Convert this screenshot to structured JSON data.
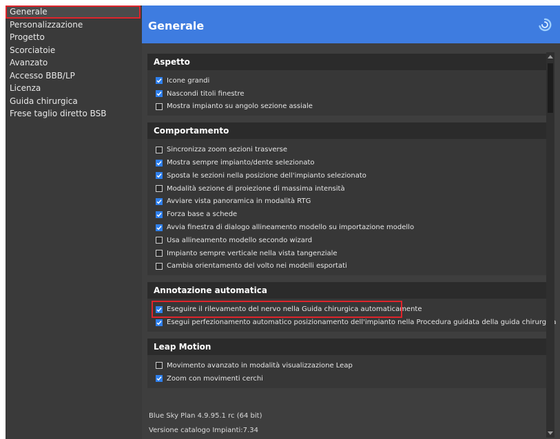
{
  "sidebar": {
    "items": [
      {
        "label": "Generale",
        "selected": true
      },
      {
        "label": "Personalizzazione"
      },
      {
        "label": "Progetto"
      },
      {
        "label": "Scorciatoie"
      },
      {
        "label": "Avanzato"
      },
      {
        "label": "Accesso BBB/LP"
      },
      {
        "label": "Licenza"
      },
      {
        "label": "Guida chirurgica"
      },
      {
        "label": "Frese taglio diretto BSB"
      }
    ]
  },
  "header": {
    "title": "Generale",
    "logo_icon": "swirl-logo-icon"
  },
  "sections": [
    {
      "title": "Aspetto",
      "options": [
        {
          "label": "Icone grandi",
          "checked": true
        },
        {
          "label": "Nascondi titoli finestre",
          "checked": true
        },
        {
          "label": "Mostra impianto su angolo sezione assiale",
          "checked": false
        }
      ]
    },
    {
      "title": "Comportamento",
      "options": [
        {
          "label": "Sincronizza zoom sezioni trasverse",
          "checked": false
        },
        {
          "label": "Mostra sempre impianto/dente selezionato",
          "checked": true
        },
        {
          "label": "Sposta le sezioni nella posizione dell'impianto selezionato",
          "checked": true
        },
        {
          "label": "Modalità sezione di proiezione di massima intensità",
          "checked": false
        },
        {
          "label": "Avviare vista panoramica in modalità RTG",
          "checked": true
        },
        {
          "label": "Forza base a schede",
          "checked": true
        },
        {
          "label": "Avvia finestra di dialogo allineamento modello su importazione modello",
          "checked": true
        },
        {
          "label": "Usa allineamento modello secondo wizard",
          "checked": false
        },
        {
          "label": "Impianto sempre verticale nella vista tangenziale",
          "checked": false
        },
        {
          "label": "Cambia orientamento del volto nei modelli esportati",
          "checked": false
        }
      ]
    },
    {
      "title": "Annotazione automatica",
      "options": [
        {
          "label": "Eseguire il rilevamento del nervo nella Guida chirurgica automaticamente",
          "checked": true,
          "highlighted": true
        },
        {
          "label": "Esegui perfezionamento automatico posizionamento dell'impianto nella Procedura guidata della guida chirurgica",
          "checked": true
        }
      ]
    },
    {
      "title": "Leap Motion",
      "options": [
        {
          "label": "Movimento avanzato in modalità visualizzazione Leap",
          "checked": false
        },
        {
          "label": "Zoom con movimenti cerchi",
          "checked": true
        }
      ]
    }
  ],
  "footer": {
    "version": "Blue Sky Plan 4.9.95.1 rc (64 bit)",
    "catalog": "Versione catalogo Impianti:7.34"
  },
  "colors": {
    "accent": "#3e7ce0",
    "checkbox": "#2f80ed",
    "highlight": "#e0242b"
  }
}
